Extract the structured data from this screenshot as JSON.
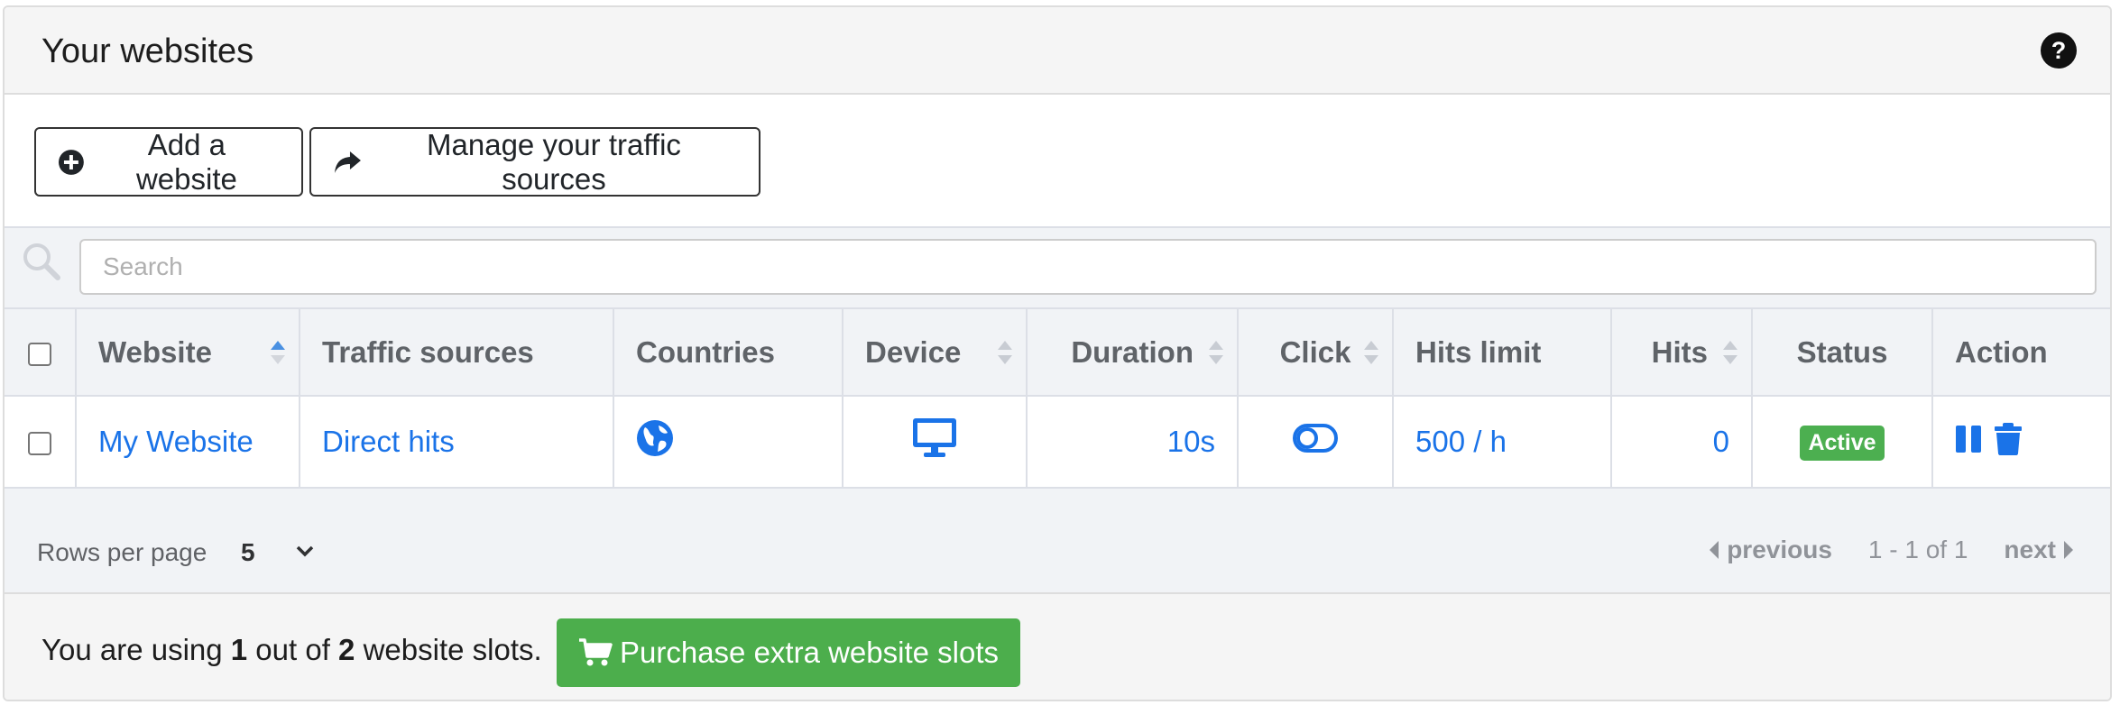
{
  "panel": {
    "title": "Your websites",
    "help_icon": "question-circle-icon"
  },
  "toolbar": {
    "add_label": "Add a website",
    "add_icon": "plus-circle-icon",
    "manage_label": "Manage your traffic sources",
    "manage_icon": "share-arrow-icon"
  },
  "search": {
    "placeholder": "Search",
    "value": ""
  },
  "table": {
    "headers": {
      "website": "Website",
      "traffic": "Traffic sources",
      "countries": "Countries",
      "device": "Device",
      "duration": "Duration",
      "click": "Click",
      "hits_limit": "Hits limit",
      "hits": "Hits",
      "status": "Status",
      "action": "Action"
    },
    "rows": [
      {
        "website": "My Website",
        "traffic": "Direct hits",
        "countries_icon": "globe-icon",
        "device_icon": "desktop-icon",
        "duration": "10s",
        "click_icon": "toggle-icon",
        "hits_limit": "500 / h",
        "hits": "0",
        "status": "Active",
        "actions": [
          "pause-icon",
          "trash-icon"
        ]
      }
    ]
  },
  "pagination": {
    "rows_per_page_label": "Rows per page",
    "rows_per_page": "5",
    "previous": "previous",
    "info": "1 - 1 of 1",
    "next": "next"
  },
  "slots": {
    "prefix": "You are using ",
    "used": "1",
    "middle": " out of ",
    "total": "2",
    "suffix": " website slots.",
    "purchase_label": "Purchase extra website slots",
    "purchase_icon": "cart-icon"
  },
  "colors": {
    "link": "#1a73e8",
    "status_active": "#4caf50",
    "purchase_button": "#4cae4c",
    "heading_bg": "#f5f5f5"
  }
}
